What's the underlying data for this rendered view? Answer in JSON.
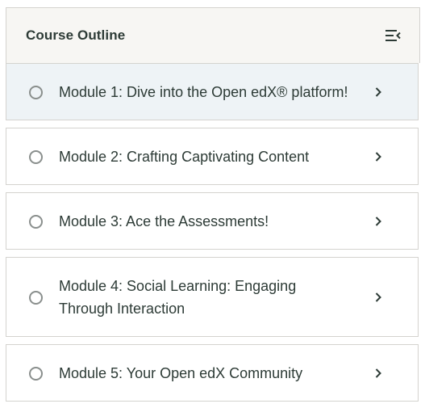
{
  "outline": {
    "title": "Course Outline",
    "collapse_icon": "collapse-menu-icon"
  },
  "modules": [
    {
      "label": "Module 1: Dive into the Open edX® platform!",
      "completed": false,
      "active": true
    },
    {
      "label": "Module 2: Crafting Captivating Content",
      "completed": false,
      "active": false
    },
    {
      "label": "Module 3: Ace the Assessments!",
      "completed": false,
      "active": false
    },
    {
      "label": "Module 4: Social Learning: Engaging Through Interaction",
      "completed": false,
      "active": false
    },
    {
      "label": "Module 5: Your Open edX Community",
      "completed": false,
      "active": false
    }
  ],
  "colors": {
    "header_bg": "#f7f6f3",
    "active_bg": "#eef3f6",
    "text": "#2d3b36",
    "border": "#d4d3cf"
  }
}
